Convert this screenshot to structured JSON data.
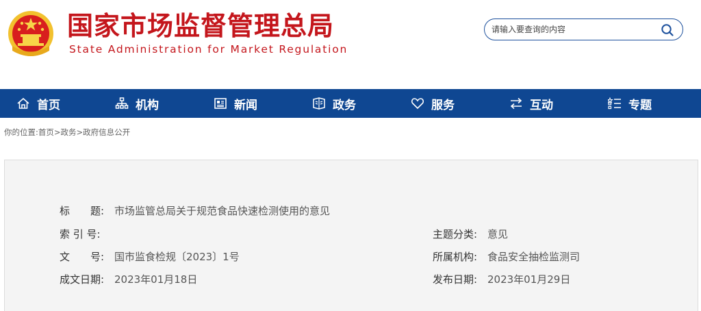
{
  "header": {
    "title_cn": "国家市场监督管理总局",
    "title_en": "State Administration for Market Regulation"
  },
  "search": {
    "placeholder": "请输入要查询的内容"
  },
  "nav": {
    "items": [
      {
        "label": "首页",
        "icon": "home-icon"
      },
      {
        "label": "机构",
        "icon": "org-chart-icon"
      },
      {
        "label": "新闻",
        "icon": "news-icon"
      },
      {
        "label": "政务",
        "icon": "government-affairs-icon"
      },
      {
        "label": "服务",
        "icon": "heart-icon"
      },
      {
        "label": "互动",
        "icon": "exchange-arrows-icon"
      },
      {
        "label": "专题",
        "icon": "topic-list-icon"
      }
    ]
  },
  "breadcrumb": {
    "prefix": "你的位置:",
    "items": [
      "首页",
      "政务",
      "政府信息公开"
    ],
    "separator": ">"
  },
  "info": {
    "title_label": "标　　题:",
    "title_value": "市场监管总局关于规范食品快速检测使用的意见",
    "index_label": "索 引 号:",
    "index_value": "",
    "doc_no_label": "文　　号:",
    "doc_no_value": "国市监食检规〔2023〕1号",
    "created_label": "成文日期:",
    "created_value": "2023年01月18日",
    "topic_label": "主题分类:",
    "topic_value": "意见",
    "org_label": "所属机构:",
    "org_value": "食品安全抽检监测司",
    "published_label": "发布日期:",
    "published_value": "2023年01月29日"
  },
  "colors": {
    "brand_red": "#c4161c",
    "nav_blue": "#0f4792",
    "emblem_gold": "#f2c12e"
  }
}
